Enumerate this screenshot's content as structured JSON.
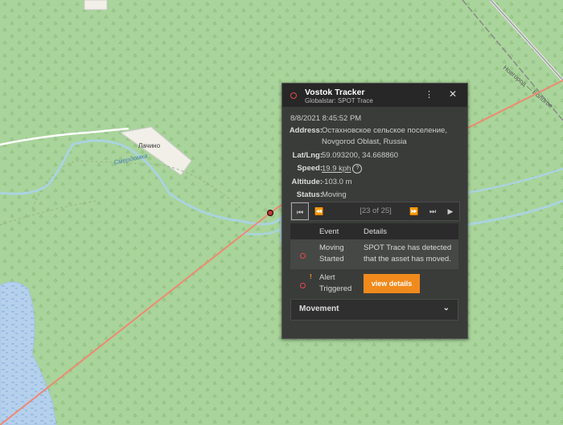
{
  "map": {
    "place_label": "Лачино",
    "river_label": "Смердомка",
    "road_label": "Новгород — Бологое",
    "colors": {
      "land": "#a9d49b",
      "forest_symbol": "#8fc07f",
      "water": "#a8cce8",
      "river": "#aad3df",
      "route": "#f08a6c",
      "road": "#ffffff",
      "boundary": "#888888"
    }
  },
  "popup": {
    "title": "Vostok Tracker",
    "subtitle": "Globalstar: SPOT Trace",
    "more_icon": "⋮",
    "close_icon": "✕",
    "timestamp": "8/8/2021 8:45:52 PM",
    "address_label": "Address:",
    "address_line1": "Остахновское сельское поселение,",
    "address_line2": "Novgorod Oblast, Russia",
    "latlng_label": "Lat/Lng:",
    "latlng": "59.093200, 34.668860",
    "speed_label": "Speed:",
    "speed": "19.9 kph",
    "help_icon": "?",
    "altitude_label": "Altitude:",
    "altitude": "-103.0 m",
    "status_label": "Status:",
    "status": "Moving",
    "nav": {
      "first_icon": "⏮",
      "prev_icon": "⏪",
      "counter": "[23 of 25]",
      "next_icon": "⏩",
      "last_icon": "⏭",
      "play_icon": "▶"
    },
    "table": {
      "headers": [
        "Event",
        "Details"
      ],
      "rows": [
        {
          "event_l1": "Moving",
          "event_l2": "Started",
          "details_l1": "SPOT Trace has detected",
          "details_l2": "that the asset has moved."
        },
        {
          "event_l1": "Alert",
          "event_l2": "Triggered",
          "warn_icon": "!",
          "details_button": "view details"
        }
      ]
    },
    "movement_label": "Movement",
    "chevron_icon": "⌄"
  }
}
